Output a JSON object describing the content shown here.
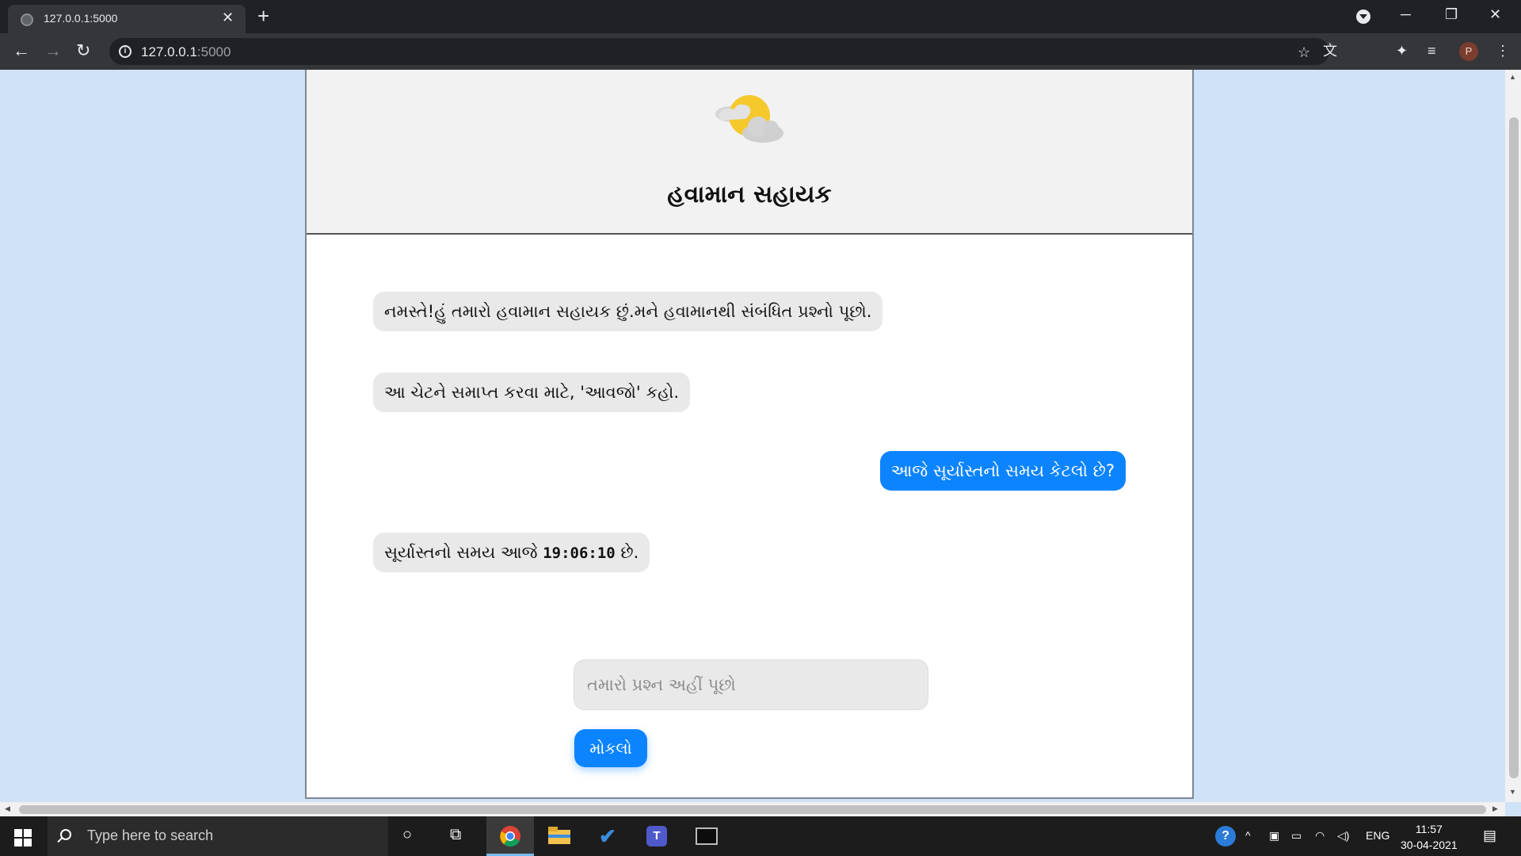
{
  "browser": {
    "tab_title": "127.0.0.1:5000",
    "url_host": "127.0.0.1",
    "url_port": ":5000"
  },
  "app": {
    "title": "હવામાન સહાયક"
  },
  "chat": {
    "messages": [
      {
        "sender": "bot",
        "text": "નમસ્તે!હું તમારો હવામાન સહાયક છું.મને હવામાનથી સંબંધિત પ્રશ્નો પૂછો."
      },
      {
        "sender": "bot",
        "text": "આ ચેટને સમાપ્ત કરવા માટે, 'આવજો' કહો."
      },
      {
        "sender": "user",
        "text": "આજે સૂર્યાસ્તનો સમય કેટલો છે?"
      },
      {
        "sender": "bot",
        "text_before": "સૂર્યાસ્તનો સમય આજે ",
        "time": "19:06:10",
        "text_after": " છે."
      }
    ],
    "input_placeholder": "તમારો પ્રશ્ન અહીં પૂછો",
    "send_label": "મોકલો"
  },
  "taskbar": {
    "search_placeholder": "Type here to search",
    "language": "ENG",
    "time": "11:57",
    "date": "30-04-2021"
  },
  "colors": {
    "page_bg": "#cfe2f8",
    "accent": "#0d84ff",
    "bot_bubble": "#e9e9ea"
  }
}
